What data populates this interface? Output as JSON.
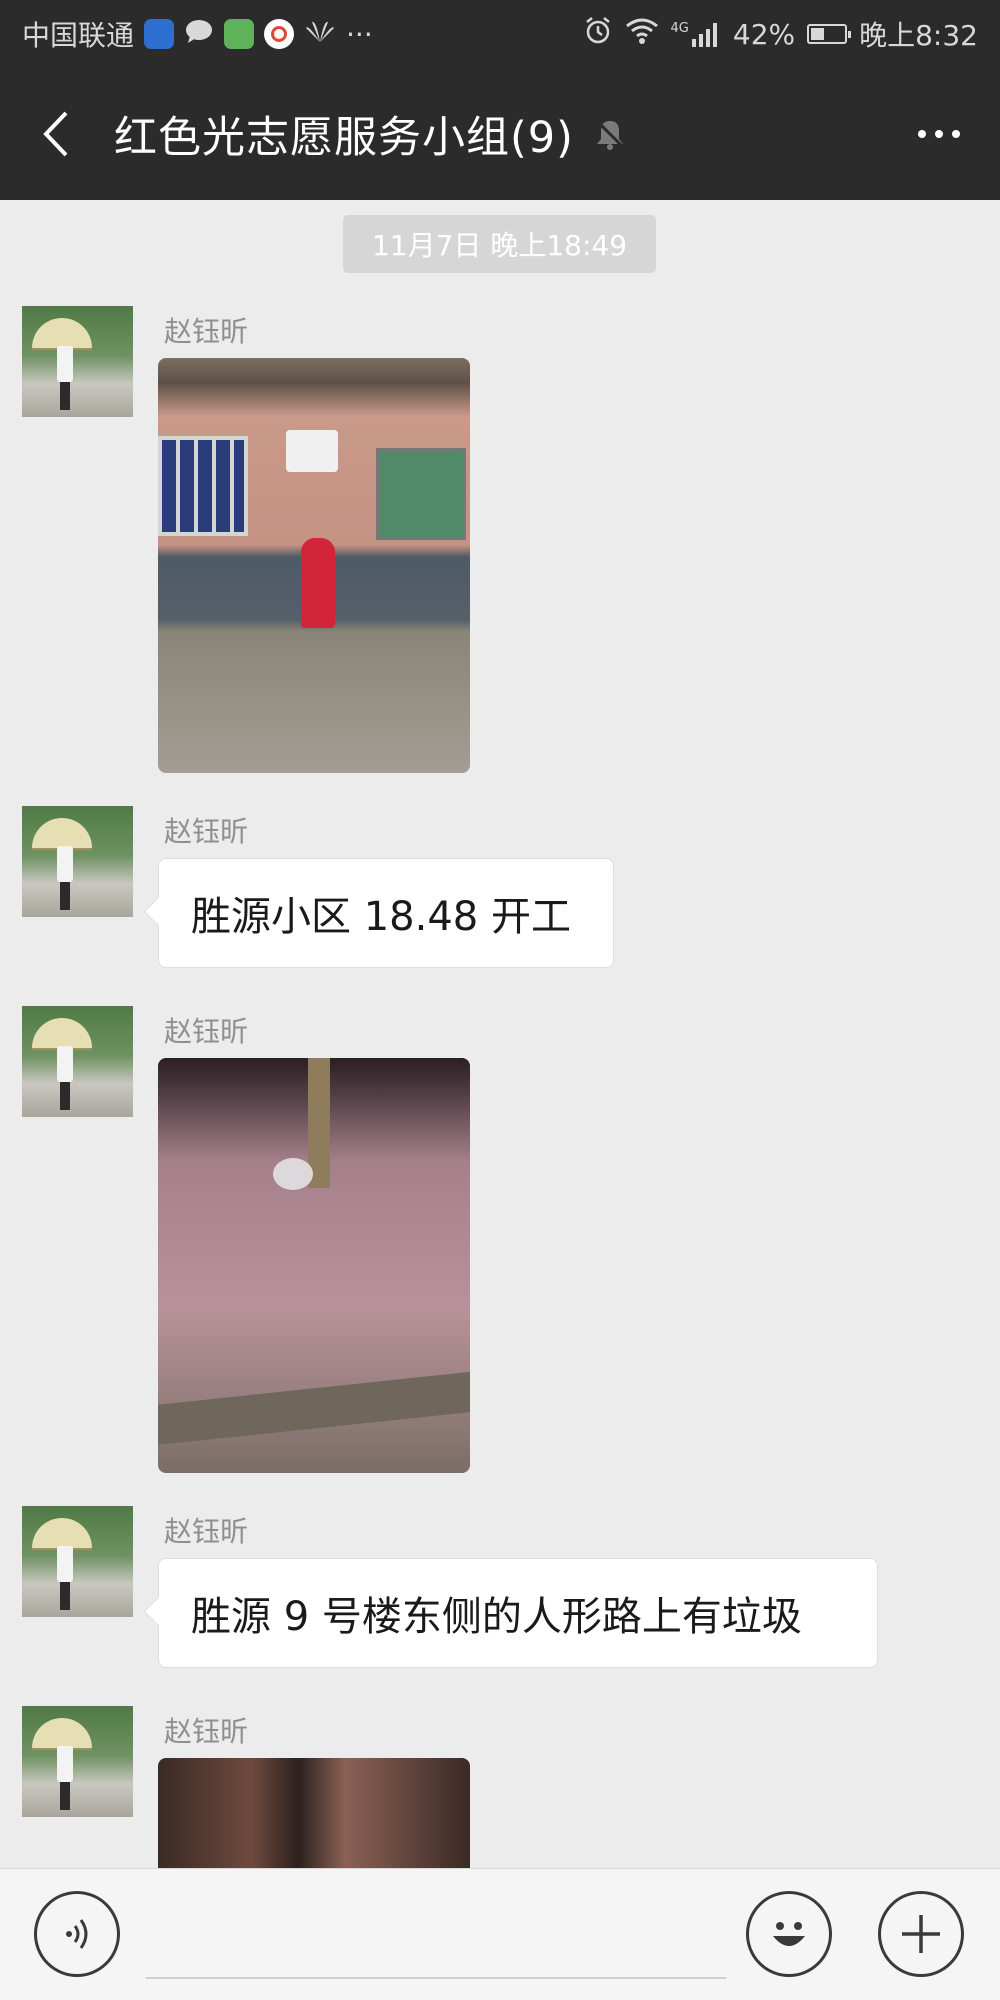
{
  "status_bar": {
    "carrier": "中国联通",
    "more": "···",
    "network": "4G",
    "battery": "42%",
    "battery_level": 0.42,
    "time": "晚上8:32"
  },
  "header": {
    "title": "红色光志愿服务小组(9)"
  },
  "timestamp": "11月7日 晚上18:49",
  "messages": [
    {
      "sender": "赵钰昕",
      "type": "image"
    },
    {
      "sender": "赵钰昕",
      "type": "text",
      "text": "胜源小区 18.48 开工"
    },
    {
      "sender": "赵钰昕",
      "type": "image"
    },
    {
      "sender": "赵钰昕",
      "type": "text",
      "text": "胜源 9 号楼东侧的人形路上有垃圾"
    },
    {
      "sender": "赵钰昕",
      "type": "image"
    }
  ],
  "input": {
    "value": "",
    "placeholder": ""
  },
  "icons": {
    "back": "back-arrow-icon",
    "mute": "mute-bell-icon",
    "more": "more-dots-icon",
    "voice": "voice-icon",
    "emoji": "emoji-icon",
    "plus": "plus-icon"
  },
  "colors": {
    "bar": "#2b2b2b",
    "chat_bg": "#ececec",
    "bubble": "#ffffff",
    "sender": "#8f8f8f"
  }
}
